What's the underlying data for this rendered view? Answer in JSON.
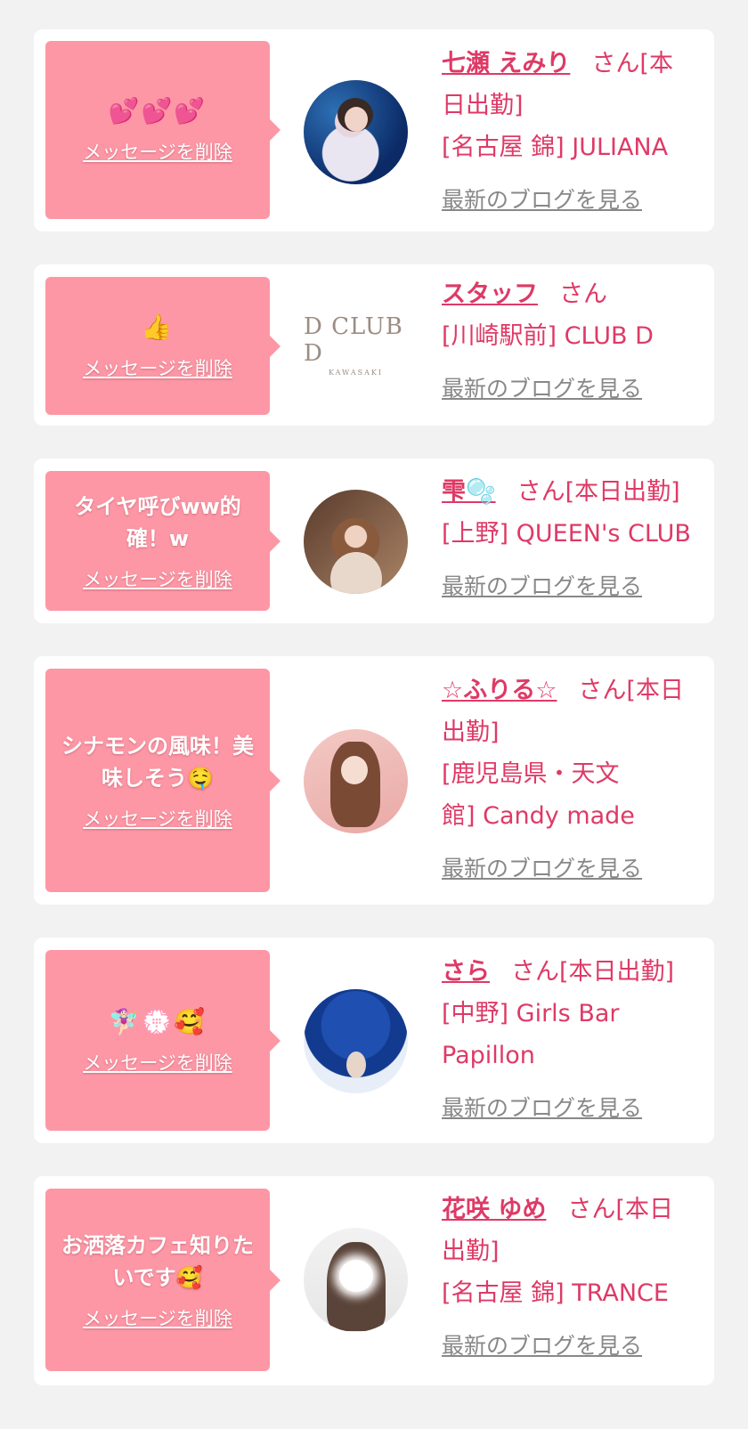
{
  "delete_label": "メッセージを削除",
  "blog_label": "最新のブログを見る",
  "accent_color": "#de3a66",
  "bubble_color": "#fd97a5",
  "items": [
    {
      "message": "💕💕💕",
      "name": "七瀬 えみり",
      "suffix": "さん[本日出勤]",
      "shop": "[名古屋 錦] JULIANA"
    },
    {
      "message": "👍",
      "name": "スタッフ",
      "suffix": "さん",
      "shop": "[川崎駅前] CLUB D",
      "logo_text": "D CLUB D",
      "logo_sub": "KAWASAKI"
    },
    {
      "message": "タイヤ呼びww的確！w",
      "name": "雫🫧",
      "suffix": "さん[本日出勤]",
      "shop": "[上野] QUEEN's CLUB"
    },
    {
      "message": "シナモンの風味！美味しそう🤤",
      "name": "☆ふりる☆",
      "suffix": "さん[本日出勤]",
      "shop": "[鹿児島県・天文館] Candy made"
    },
    {
      "message": "🧚🏻‍♀️💮🥰",
      "name": "さら",
      "suffix": "さん[本日出勤]",
      "shop": "[中野] Girls Bar Papillon"
    },
    {
      "message": "お洒落カフェ知りたいです🥰",
      "name": "花咲 ゆめ",
      "suffix": "さん[本日出勤]",
      "shop": "[名古屋 錦] TRANCE"
    }
  ]
}
